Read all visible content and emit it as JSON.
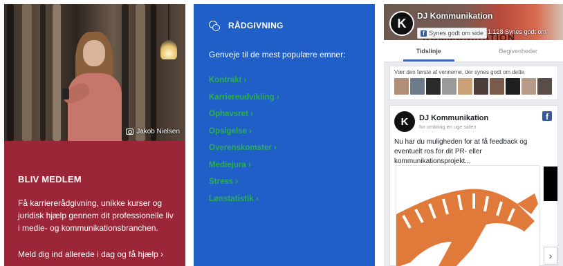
{
  "left": {
    "photo_credit": "Jakob Nielsen",
    "member_title": "BLIV MEDLEM",
    "member_text": "Få karriererådgivning, unikke kurser og juridisk hjælp gennem dit professionelle liv i medie- og kommunikationsbranchen.",
    "member_link": "Meld dig ind allerede i dag og få hjælp ›"
  },
  "mid": {
    "title": "RÅDGIVNING",
    "subtitle": "Genveje til de mest populære emner:",
    "topics": [
      "Kontrakt ›",
      "Karriereudvikling ›",
      "Ophavsret ›",
      "Opsigelse ›",
      "Overenskomster ›",
      "Mediejura ›",
      "Stress ›",
      "Lønstatistik ›"
    ],
    "topic_color": "#2bb14a",
    "background": "#1f5fc7"
  },
  "facebook": {
    "page_name": "DJ Kommunikation",
    "logo_letter": "K",
    "like_button": "Synes godt om side",
    "likes_count": "1.128 Synes godt om",
    "cover_text": "KOMMUNIKATION",
    "tabs": [
      "Tidslinje",
      "Begivenheder"
    ],
    "friends_text": "Vær den første af vennerne, der synes godt om dette",
    "post": {
      "author": "DJ Kommunikation",
      "sub": "for omkring en uge siden",
      "text": "Nu har du muligheden for at få feedback og eventuelt ros for dit PR- eller kommunikationsprojekt...",
      "fb_icon": "f",
      "next_icon": "›"
    },
    "brand_color": "#3b5998"
  }
}
